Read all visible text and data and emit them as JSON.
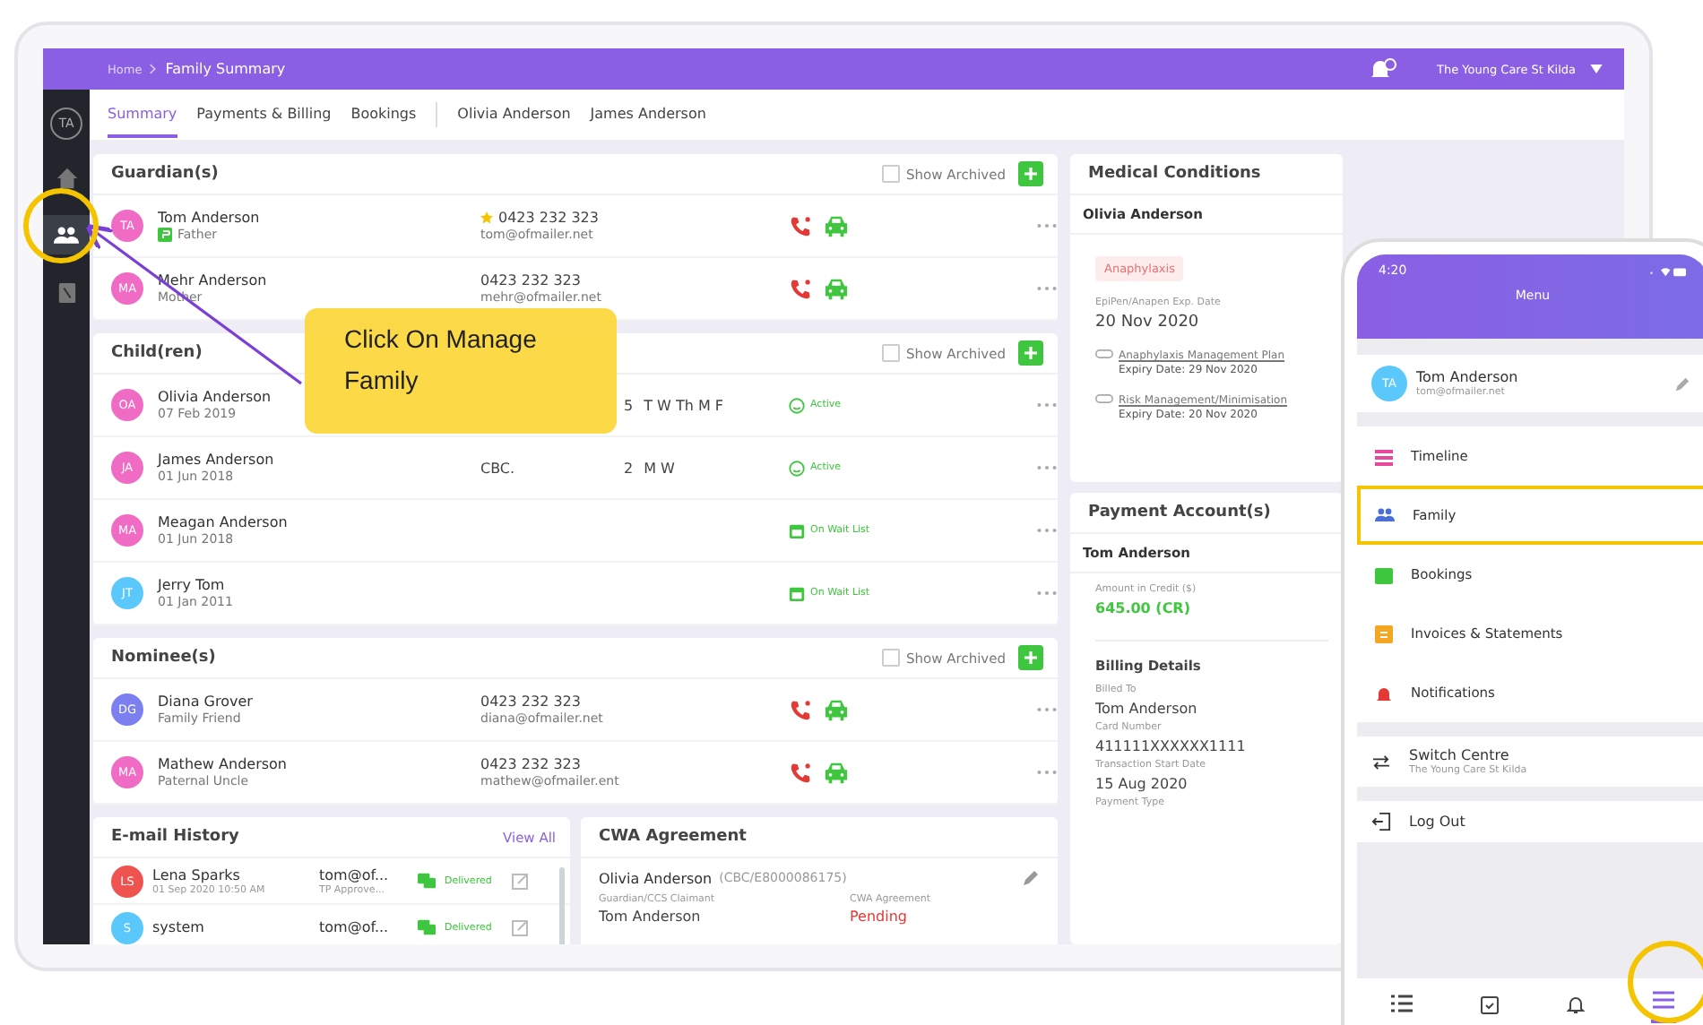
{
  "sidebar": {
    "avatar": "TA",
    "items": [
      {
        "kind": "home",
        "selected": false
      },
      {
        "kind": "family",
        "selected": true
      },
      {
        "kind": "book",
        "selected": false
      }
    ]
  },
  "header": {
    "breadcrumb": [
      "Home",
      "Family Summary"
    ],
    "centre": "The Young Care St Kilda"
  },
  "tabs": [
    {
      "label": "Summary",
      "kind": "page",
      "selected": true
    },
    {
      "label": "Payments & Billing",
      "kind": "page",
      "selected": false
    },
    {
      "label": "Bookings",
      "kind": "page",
      "selected": false
    },
    {
      "label": "Olivia Anderson",
      "kind": "child",
      "selected": false
    },
    {
      "label": "James Anderson",
      "kind": "child",
      "selected": false
    }
  ],
  "guardians": {
    "title": "Guardian(s)",
    "show_archived": {
      "label": "Show Archived",
      "checked": false
    },
    "rows": [
      {
        "initials": "TA",
        "color": "#f06bc3",
        "name": "Tom Anderson",
        "relation": "Father",
        "primary": true,
        "starred": true,
        "phone": "0423 232 323",
        "email": "tom@ofmailer.net"
      },
      {
        "initials": "MA",
        "color": "#f06bc3",
        "name": "Mehr Anderson",
        "relation": "Mother",
        "primary": false,
        "starred": false,
        "phone": "0423 232 323",
        "email": "mehr@ofmailer.net"
      }
    ]
  },
  "children": {
    "title": "Child(ren)",
    "show_archived": {
      "label": "Show Archived",
      "checked": false
    },
    "rows": [
      {
        "initials": "OA",
        "color": "#f06bc3",
        "name": "Olivia Anderson",
        "dob": "07 Feb 2019",
        "count": "5",
        "days": "T W Th M F",
        "status": "Active",
        "kind": "active"
      },
      {
        "initials": "JA",
        "color": "#f06bc3",
        "name": "James Anderson",
        "dob": "01 Jun 2018",
        "room": "CBC.",
        "count": "2",
        "days": "M W",
        "status": "Active",
        "kind": "active"
      },
      {
        "initials": "MA",
        "color": "#f06bc3",
        "name": "Meagan Anderson",
        "dob": "01 Jun 2018",
        "status": "On Wait List",
        "kind": "waitlist"
      },
      {
        "initials": "JT",
        "color": "#5ac8fa",
        "name": "Jerry Tom",
        "dob": "01 Jan 2011",
        "status": "On Wait List",
        "kind": "waitlist"
      }
    ]
  },
  "nominees": {
    "title": "Nominee(s)",
    "show_archived": {
      "label": "Show Archived",
      "checked": false
    },
    "rows": [
      {
        "initials": "DG",
        "color": "#7b7ff0",
        "name": "Diana Grover",
        "relation": "Family Friend",
        "phone": "0423 232 323",
        "email": "diana@ofmailer.net"
      },
      {
        "initials": "MA",
        "color": "#f06bc3",
        "name": "Mathew Anderson",
        "relation": "Paternal Uncle",
        "phone": "0423 232 323",
        "email": "mathew@ofmailer.ent"
      }
    ]
  },
  "email_history": {
    "title": "E-mail History",
    "link": "View All",
    "rows": [
      {
        "initials": "LS",
        "color": "#ef5350",
        "name": "Lena Sparks",
        "date": "01 Sep 2020 10:50 AM",
        "to": "tom@of...",
        "subject": "TP Approve...",
        "status": "Delivered"
      },
      {
        "initials": "S",
        "color": "#5ac8fa",
        "name": "system",
        "to": "tom@of...",
        "status": "Delivered"
      }
    ]
  },
  "cwa": {
    "title": "CWA Agreement",
    "child": "Olivia Anderson",
    "code": "(CBC/E8000086175)",
    "claimant_label": "Guardian/CCS Claimant",
    "claimant": "Tom Anderson",
    "agreement_label": "CWA Agreement",
    "agreement": "Pending"
  },
  "medical": {
    "title": "Medical Conditions",
    "child": "Olivia Anderson",
    "tag": "Anaphylaxis",
    "exp_label": "EpiPen/Anapen Exp. Date",
    "exp": "20 Nov 2020",
    "documents": [
      {
        "name": "Anaphylaxis Management Plan",
        "expiry": "Expiry Date: 29 Nov 2020"
      },
      {
        "name": "Risk Management/Minimisation",
        "expiry": "Expiry Date: 20 Nov 2020"
      }
    ]
  },
  "payment": {
    "title": "Payment Account(s)",
    "account": "Tom Anderson",
    "credit_label": "Amount in Credit ($)",
    "credit": "645.00 (CR)",
    "billing_title": "Billing Details",
    "fields": [
      {
        "label": "Billed To",
        "value": "Tom Anderson"
      },
      {
        "label": "Card Number",
        "value": "411111XXXXXX1111"
      },
      {
        "label": "Transaction Start Date",
        "value": "15 Aug 2020"
      },
      {
        "label": "Payment Type"
      }
    ]
  },
  "callout": "Click On Manage Family",
  "phone": {
    "time": "4:20",
    "title": "Menu",
    "profile": {
      "initials": "TA",
      "name": "Tom Anderson",
      "email": "tom@ofmailer.net"
    },
    "items": [
      {
        "kind": "timeline",
        "label": "Timeline",
        "selected": false
      },
      {
        "kind": "family",
        "label": "Family",
        "selected": true
      },
      {
        "kind": "bookings",
        "label": "Bookings",
        "selected": false
      },
      {
        "kind": "invoices",
        "label": "Invoices & Statements",
        "selected": false
      },
      {
        "kind": "notifications",
        "label": "Notifications",
        "selected": false
      }
    ],
    "switch": {
      "label": "Switch Centre",
      "centre": "The Young Care St Kilda"
    },
    "logout": "Log Out",
    "tabbar": [
      {
        "kind": "list",
        "selected": false
      },
      {
        "kind": "calendar",
        "selected": false
      },
      {
        "kind": "bell",
        "selected": false
      },
      {
        "kind": "menu",
        "selected": true
      }
    ]
  }
}
